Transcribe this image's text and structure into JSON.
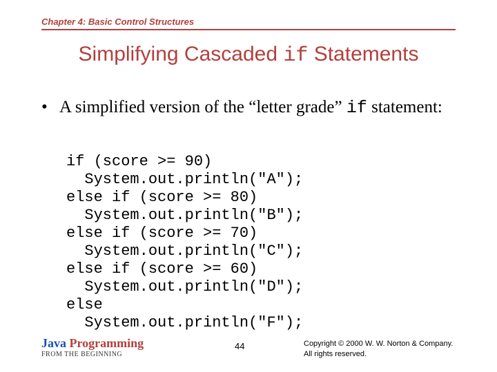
{
  "chapter": "Chapter 4: Basic Control Structures",
  "title_pre": "Simplifying Cascaded ",
  "title_code": "if",
  "title_post": " Statements",
  "bullet_pre": "A simplified version of the “letter grade” ",
  "bullet_code": "if",
  "bullet_post": " statement:",
  "code": "if (score >= 90)\n  System.out.println(\"A\");\nelse if (score >= 80)\n  System.out.println(\"B\");\nelse if (score >= 70)\n  System.out.println(\"C\");\nelse if (score >= 60)\n  System.out.println(\"D\");\nelse\n  System.out.println(\"F\");",
  "footer": {
    "java": "Java",
    "programming": " Programming",
    "sub": "FROM THE BEGINNING",
    "page": "44",
    "copy1": "Copyright © 2000 W. W. Norton & Company.",
    "copy2": "All rights reserved."
  }
}
